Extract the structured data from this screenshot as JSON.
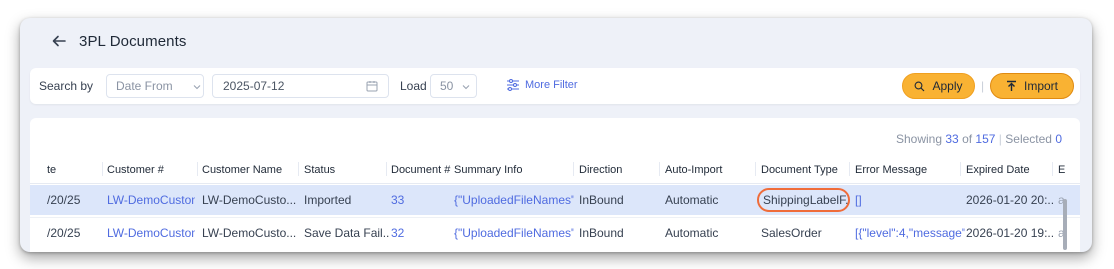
{
  "header": {
    "title": "3PL Documents"
  },
  "filters": {
    "search_by_label": "Search by",
    "date_field_selected": "Date From",
    "date_value": "2025-07-12",
    "load_label": "Load",
    "load_value": "50",
    "more_filter_label": "More Filter",
    "apply_label": "Apply",
    "import_label": "Import",
    "divider": "|"
  },
  "summary": {
    "showing_label": "Showing",
    "showing_count": "33",
    "of_label": "of",
    "total": "157",
    "separator": "|",
    "selected_label": "Selected",
    "selected_count": "0"
  },
  "table": {
    "columns": [
      "te",
      "Customer #",
      "Customer Name",
      "Status",
      "Document #",
      "Summary Info",
      "Direction",
      "Auto-Import",
      "Document Type",
      "Error Message",
      "Expired Date",
      "E"
    ],
    "rows": [
      [
        "/20/25",
        "LW-DemoCustom",
        "LW-DemoCusto...",
        "Imported",
        "33",
        "{\"UploadedFileNames\":'",
        "InBound",
        "Automatic",
        "ShippingLabelF...",
        "[]",
        "2026-01-20 20:...",
        "a"
      ],
      [
        "/20/25",
        "LW-DemoCustom",
        "LW-DemoCusto...",
        "Save Data Fail...",
        "32",
        "{\"UploadedFileNames\":'",
        "InBound",
        "Automatic",
        "SalesOrder",
        "[{\"level\":4,\"message\"",
        "2026-01-20 19:...",
        "a"
      ]
    ]
  },
  "colors": {
    "accent": "#4f6be0",
    "button": "#f9b233",
    "selected_row": "#dce6fa",
    "highlight": "#ef6c3a"
  },
  "icons": {
    "back": "arrow-left-icon",
    "chevron": "chevron-down-icon",
    "calendar": "calendar-icon",
    "filter": "filter-icon",
    "search": "search-icon",
    "import": "import-icon"
  }
}
